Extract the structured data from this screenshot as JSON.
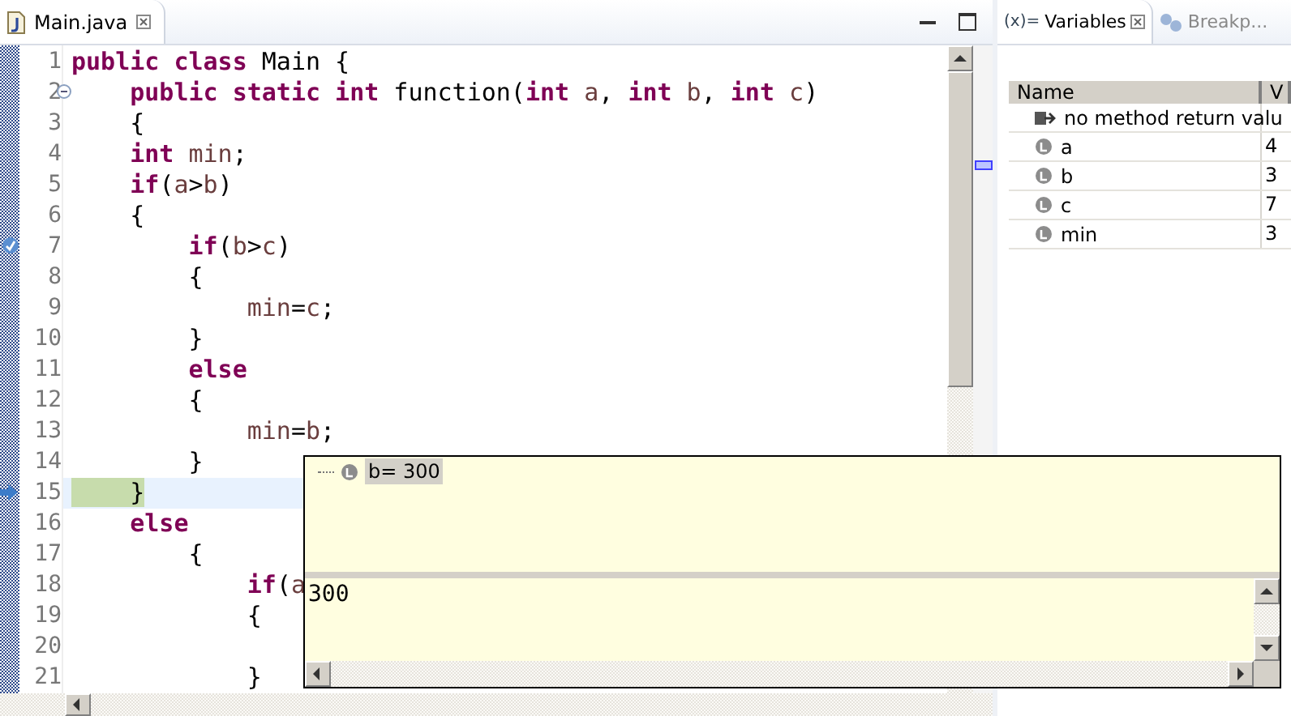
{
  "editor": {
    "tabs": [
      {
        "label": "Main.java",
        "selected": true
      }
    ],
    "lines": [
      {
        "n": "1",
        "current": false,
        "tokens": [
          {
            "kind": "keyword",
            "text": "public class"
          },
          {
            "kind": "plain",
            "text": " Main {"
          }
        ]
      },
      {
        "n": "2",
        "current": false,
        "kind": "fold",
        "tokens": [
          {
            "kind": "keyword",
            "text": "    public static int"
          },
          {
            "kind": "plain",
            "text": " function("
          },
          {
            "kind": "keyword",
            "text": "int"
          },
          {
            "kind": "variable",
            "text": " a"
          },
          {
            "kind": "plain",
            "text": ", "
          },
          {
            "kind": "keyword",
            "text": "int"
          },
          {
            "kind": "variable",
            "text": " b"
          },
          {
            "kind": "plain",
            "text": ", "
          },
          {
            "kind": "keyword",
            "text": "int"
          },
          {
            "kind": "variable",
            "text": " c"
          },
          {
            "kind": "plain",
            "text": ")"
          }
        ]
      },
      {
        "n": "3",
        "current": false,
        "tokens": [
          {
            "kind": "plain",
            "text": "    {"
          }
        ]
      },
      {
        "n": "4",
        "current": false,
        "tokens": [
          {
            "kind": "keyword",
            "text": "    int"
          },
          {
            "kind": "variable",
            "text": " min"
          },
          {
            "kind": "plain",
            "text": ";"
          }
        ]
      },
      {
        "n": "5",
        "current": false,
        "tokens": [
          {
            "kind": "keyword",
            "text": "    if"
          },
          {
            "kind": "plain",
            "text": "("
          },
          {
            "kind": "variable",
            "text": "a"
          },
          {
            "kind": "plain",
            "text": ">"
          },
          {
            "kind": "variable",
            "text": "b"
          },
          {
            "kind": "plain",
            "text": ")"
          }
        ]
      },
      {
        "n": "6",
        "current": false,
        "tokens": [
          {
            "kind": "plain",
            "text": "    {"
          }
        ]
      },
      {
        "n": "7",
        "current": false,
        "kind": "stack",
        "tokens": [
          {
            "kind": "keyword",
            "text": "        if"
          },
          {
            "kind": "plain",
            "text": "("
          },
          {
            "kind": "variable",
            "text": "b"
          },
          {
            "kind": "plain",
            "text": ">"
          },
          {
            "kind": "variable",
            "text": "c"
          },
          {
            "kind": "plain",
            "text": ")"
          }
        ]
      },
      {
        "n": "8",
        "current": false,
        "tokens": [
          {
            "kind": "plain",
            "text": "        {"
          }
        ]
      },
      {
        "n": "9",
        "current": false,
        "tokens": [
          {
            "kind": "variable",
            "text": "            min"
          },
          {
            "kind": "plain",
            "text": "="
          },
          {
            "kind": "variable",
            "text": "c"
          },
          {
            "kind": "plain",
            "text": ";"
          }
        ]
      },
      {
        "n": "10",
        "current": false,
        "tokens": [
          {
            "kind": "plain",
            "text": "        }"
          }
        ]
      },
      {
        "n": "11",
        "current": false,
        "tokens": [
          {
            "kind": "keyword",
            "text": "        else"
          }
        ]
      },
      {
        "n": "12",
        "current": false,
        "tokens": [
          {
            "kind": "plain",
            "text": "        {"
          }
        ]
      },
      {
        "n": "13",
        "current": false,
        "tokens": [
          {
            "kind": "variable",
            "text": "            min"
          },
          {
            "kind": "plain",
            "text": "="
          },
          {
            "kind": "variable",
            "text": "b"
          },
          {
            "kind": "plain",
            "text": ";"
          }
        ]
      },
      {
        "n": "14",
        "current": false,
        "tokens": [
          {
            "kind": "plain",
            "text": "        }"
          }
        ]
      },
      {
        "n": "15",
        "current": true,
        "kind": "arrow",
        "tokens": [
          {
            "kind": "plain",
            "text": "    }"
          }
        ]
      },
      {
        "n": "16",
        "current": false,
        "tokens": [
          {
            "kind": "keyword",
            "text": "    else"
          }
        ]
      },
      {
        "n": "17",
        "current": false,
        "tokens": [
          {
            "kind": "plain",
            "text": "        {"
          }
        ]
      },
      {
        "n": "18",
        "current": false,
        "tokens": [
          {
            "kind": "keyword",
            "text": "            if"
          },
          {
            "kind": "plain",
            "text": "("
          },
          {
            "kind": "variable",
            "text": "a"
          }
        ]
      },
      {
        "n": "19",
        "current": false,
        "tokens": [
          {
            "kind": "plain",
            "text": "            {"
          }
        ]
      },
      {
        "n": "20",
        "current": false
      },
      {
        "n": "21",
        "current": false,
        "tokens": [
          {
            "kind": "plain",
            "text": "            }"
          }
        ]
      }
    ]
  },
  "hover_popup": {
    "tree": [
      {
        "label": "b= 300",
        "selected": true
      }
    ],
    "detail": "300"
  },
  "views": {
    "tabs": [
      {
        "icon_text": "(x)=",
        "label": "Variables",
        "selected": true
      },
      {
        "label": "Breakp...",
        "selected": false
      }
    ],
    "table": {
      "columns": [
        "Name",
        "V"
      ],
      "rows": [
        {
          "kind": "return",
          "name": "no method return valu"
        },
        {
          "kind": "local",
          "name": "a",
          "value": "4"
        },
        {
          "kind": "local",
          "name": "b",
          "value": "3"
        },
        {
          "kind": "local",
          "name": "c",
          "value": "7"
        },
        {
          "kind": "local",
          "name": "min",
          "value": "3"
        }
      ]
    }
  }
}
